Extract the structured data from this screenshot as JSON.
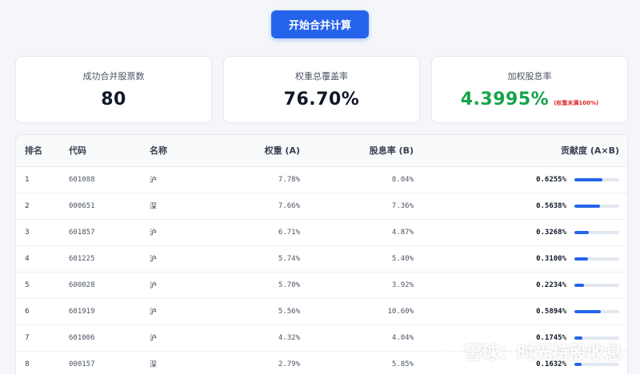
{
  "toolbar": {
    "start_label": "开始合并计算"
  },
  "cards": [
    {
      "label": "成功合并股票数",
      "value": "80"
    },
    {
      "label": "权重总覆盖率",
      "value": "76.70%"
    },
    {
      "label": "加权股息率",
      "value": "4.3995%",
      "note": "(权重未满100%)"
    }
  ],
  "colors": {
    "accent": "#2563eb",
    "positive": "#16a34a",
    "warning": "#dc2626"
  },
  "table": {
    "columns": [
      "排名",
      "代码",
      "名称",
      "权重 (A)",
      "股息率 (B)",
      "贡献度 (A×B)"
    ],
    "rows": [
      {
        "rank": "1",
        "code": "601088",
        "name": "沪",
        "weight": "7.78%",
        "yield": "8.04%",
        "contrib": "0.6255%",
        "contrib_num": 0.6255
      },
      {
        "rank": "2",
        "code": "000651",
        "name": "深",
        "weight": "7.66%",
        "yield": "7.36%",
        "contrib": "0.5638%",
        "contrib_num": 0.5638
      },
      {
        "rank": "3",
        "code": "601857",
        "name": "沪",
        "weight": "6.71%",
        "yield": "4.87%",
        "contrib": "0.3268%",
        "contrib_num": 0.3268
      },
      {
        "rank": "4",
        "code": "601225",
        "name": "沪",
        "weight": "5.74%",
        "yield": "5.40%",
        "contrib": "0.3100%",
        "contrib_num": 0.31
      },
      {
        "rank": "5",
        "code": "600028",
        "name": "沪",
        "weight": "5.70%",
        "yield": "3.92%",
        "contrib": "0.2234%",
        "contrib_num": 0.2234
      },
      {
        "rank": "6",
        "code": "601919",
        "name": "沪",
        "weight": "5.56%",
        "yield": "10.60%",
        "contrib": "0.5894%",
        "contrib_num": 0.5894
      },
      {
        "rank": "7",
        "code": "601006",
        "name": "沪",
        "weight": "4.32%",
        "yield": "4.04%",
        "contrib": "0.1745%",
        "contrib_num": 0.1745
      },
      {
        "rank": "8",
        "code": "000157",
        "name": "深",
        "weight": "2.79%",
        "yield": "5.85%",
        "contrib": "0.1632%",
        "contrib_num": 0.1632
      }
    ]
  },
  "watermark": {
    "text": "雪球：时光持股收息"
  }
}
